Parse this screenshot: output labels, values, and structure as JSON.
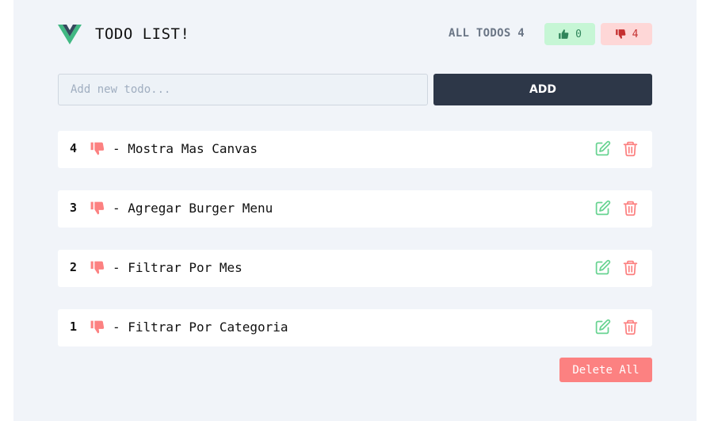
{
  "header": {
    "title": "TODO LIST!",
    "counts_label": "ALL TODOS 4",
    "up_count": "0",
    "down_count": "4"
  },
  "add": {
    "placeholder": "Add new todo...",
    "button_label": "ADD"
  },
  "todos": [
    {
      "number": "4",
      "status_icon": "thumbs-down-icon",
      "text": "- Mostra Mas Canvas"
    },
    {
      "number": "3",
      "status_icon": "thumbs-down-icon",
      "text": "- Agregar Burger Menu"
    },
    {
      "number": "2",
      "status_icon": "thumbs-down-icon",
      "text": "- Filtrar Por Mes"
    },
    {
      "number": "1",
      "status_icon": "thumbs-down-icon",
      "text": "- Filtrar Por Categoria"
    }
  ],
  "actions": {
    "delete_all_label": "Delete All"
  },
  "colors": {
    "vue_green": "#41b883",
    "vue_dark": "#35495e",
    "thumb_down": "#fc8181",
    "edit_green": "#68d391",
    "delete_red": "#fc8181",
    "add_button_bg": "#2d3748"
  }
}
